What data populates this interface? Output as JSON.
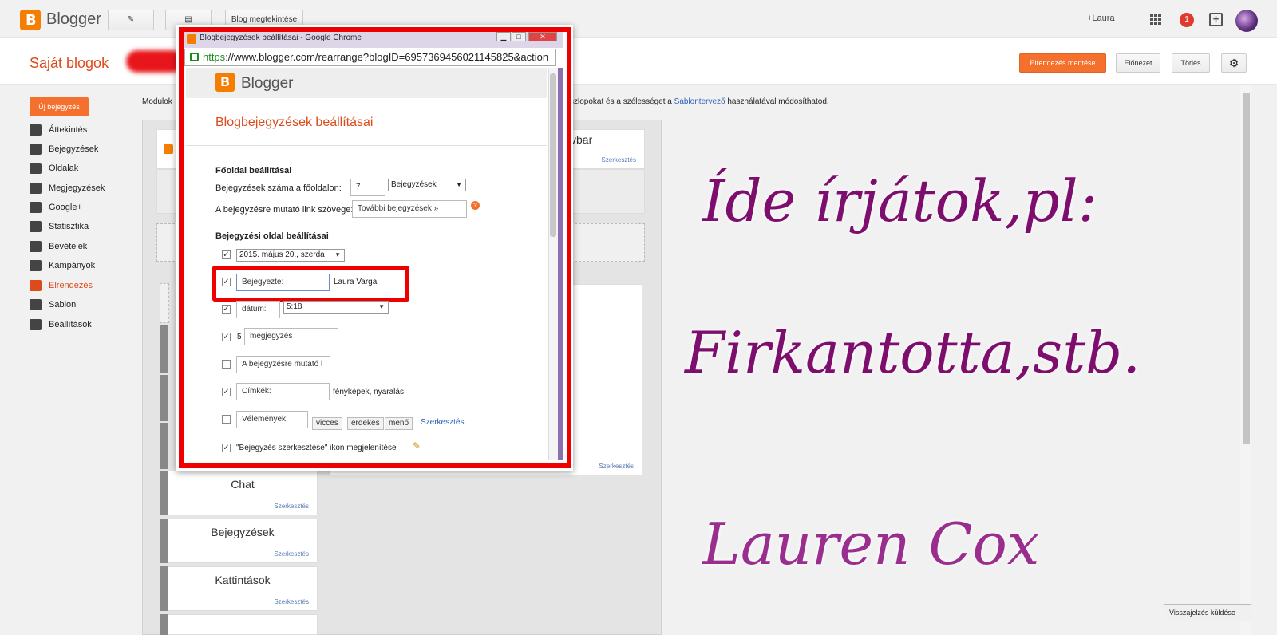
{
  "topbar": {
    "brand": "Blogger",
    "view_blog": "Blog megtekintése",
    "user": "+Laura",
    "notifications": "1"
  },
  "subbar": {
    "title": "Saját blogok",
    "save": "Elrendezés mentése",
    "preview": "Előnézet",
    "delete": "Törlés"
  },
  "sidebar": {
    "new_post": "Új bejegyzés",
    "items": [
      {
        "label": "Áttekintés",
        "icon": "home-icon"
      },
      {
        "label": "Bejegyzések",
        "icon": "posts-icon"
      },
      {
        "label": "Oldalak",
        "icon": "pages-icon"
      },
      {
        "label": "Megjegyzések",
        "icon": "comments-icon"
      },
      {
        "label": "Google+",
        "icon": "google-plus-icon"
      },
      {
        "label": "Statisztika",
        "icon": "stats-icon"
      },
      {
        "label": "Bevételek",
        "icon": "trophy-icon"
      },
      {
        "label": "Kampányok",
        "icon": "adwords-icon"
      },
      {
        "label": "Elrendezés",
        "icon": "layout-icon"
      },
      {
        "label": "Sablon",
        "icon": "paint-roller-icon"
      },
      {
        "label": "Beállítások",
        "icon": "wrench-icon"
      }
    ]
  },
  "info": {
    "pre": "Modulok",
    "post": "it. Az oszlopokat és a szélességet a ",
    "link": "Sablontervező",
    "post2": " használatával módosíthatod."
  },
  "layout": {
    "edit": "Szerkesztés",
    "navbar_suffix": "vbar",
    "gadgets": [
      "Chat",
      "Bejegyzések",
      "Kattintások"
    ]
  },
  "popup": {
    "window_title": "Blogbejegyzések beállításai - Google Chrome",
    "url_scheme": "https",
    "url_rest": "://www.blogger.com/rearrange?blogID=6957369456021145825&action",
    "brand": "Blogger",
    "heading": "Blogbejegyzések beállításai",
    "main_section": "Főoldal beállításai",
    "posts_count_label": "Bejegyzések száma a főoldalon:",
    "posts_count": "7",
    "posts_unit": "Bejegyzések",
    "link_text_label": "A bejegyzésre mutató link szövege:",
    "link_text": "További bejegyzések »",
    "post_section": "Bejegyzési oldal beállításai",
    "date_format": "2015. május 20., szerda",
    "posted_by": "Bejegyezte:",
    "author": "Laura Varga",
    "time_label": "dátum:",
    "time_value": "5:18",
    "comments_count": "5",
    "comments_label": "megjegyzés",
    "link_label": "A bejegyzésre mutató l",
    "labels_label": "Címkék:",
    "labels_value": "fényképek, nyaralás",
    "reactions_label": "Vélemények:",
    "reactions": [
      "vicces",
      "érdekes",
      "menő"
    ],
    "reactions_edit": "Szerkesztés",
    "edit_icon_label": "\"Bejegyzés szerkesztése\" ikon megjelenítése"
  },
  "overlay": {
    "line1": "Íde írjátok,pl:",
    "line2": "Firkantotta,stb.",
    "line3": "Lauren Cox"
  },
  "feedback": "Visszajelzés küldése"
}
